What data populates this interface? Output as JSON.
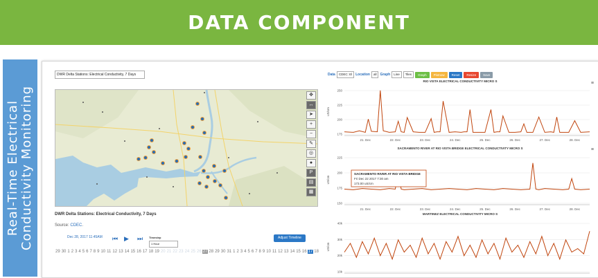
{
  "banner": {
    "title": "DATA COMPONENT"
  },
  "sidebar": {
    "line1": "Real-Time Electrical",
    "line2": "Conductivity Monitoring"
  },
  "left_panel": {
    "station_select": "DWR Delta Stations: Electrical Conductivity, 7 Days",
    "map_title": "DWR Delta Stations: Electrical Conductivity, 7 Days",
    "source_label": "Source:",
    "source_link": "CDEC",
    "timestamp": "Dec 28, 2017 11:45AM",
    "timestep_label": "Timestep",
    "timestep_value": "1 Hour",
    "adjust_button": "Adjust Timeline",
    "map_tools": [
      "pan-icon",
      "zoom-extent-icon",
      "cursor-icon",
      "zoom-in-icon",
      "zoom-out-icon",
      "edit-icon",
      "globe-icon",
      "info-icon",
      "print-icon",
      "layers-icon",
      "basemap-icon"
    ],
    "timeline": [
      "29",
      "30",
      "1",
      "2",
      "3",
      "4",
      "5",
      "6",
      "7",
      "8",
      "9",
      "10",
      "11",
      "12",
      "13",
      "14",
      "15",
      "16",
      "17",
      "18",
      "19",
      "20",
      "21",
      "22",
      "23",
      "24",
      "25",
      "26",
      "27",
      "28",
      "29",
      "30",
      "31",
      "1",
      "2",
      "3",
      "4",
      "5",
      "6",
      "7",
      "8",
      "9",
      "10",
      "11",
      "12",
      "13",
      "14",
      "15",
      "16",
      "17",
      "18"
    ]
  },
  "right_panel": {
    "data_label": "Data",
    "data_value": "CDEC: El",
    "location_label": "Location",
    "location_value": "all",
    "graph_label": "Graph",
    "graph_value": "Line",
    "tiles_value": "Tiles",
    "buttons": {
      "graph": "Graph",
      "plotnow": "Plotnow",
      "reset": "Reset",
      "resize": "Resize",
      "save": "Save"
    },
    "colors": {
      "graph": "#6cbf45",
      "plotnow": "#f5b63f",
      "reset": "#2b78c6",
      "resize": "#e8472f",
      "save": "#8a9ba8",
      "series": "#c0440c"
    },
    "tooltip": {
      "title": "SACRAMENTO RIVER AT RIO VISTA BRIDGE",
      "date": "Fri Dec 22 2017 7:30 am",
      "value": "173.00 uS/cm"
    }
  },
  "chart_data": [
    {
      "type": "line",
      "title": "RIO VISTA ELECTRICAL CONDUCTIVITY MICRO S",
      "ylabel": "uS/cm",
      "y_ticks": [
        "250",
        "225",
        "200",
        "175"
      ],
      "ylim": [
        165,
        255
      ],
      "x_ticks": [
        "21. Dec",
        "22. Dec",
        "23. Dec",
        "24. Dec",
        "25. Dec",
        "26. Dec",
        "27. Dec",
        "28. Dec"
      ],
      "xlim": [
        20.3,
        28.5
      ],
      "x": [
        20.3,
        20.6,
        20.8,
        21.0,
        21.1,
        21.2,
        21.4,
        21.5,
        21.6,
        21.8,
        22.0,
        22.1,
        22.2,
        22.3,
        22.4,
        22.6,
        22.8,
        23.0,
        23.2,
        23.3,
        23.4,
        23.5,
        23.6,
        23.8,
        24.0,
        24.2,
        24.3,
        24.4,
        24.5,
        24.6,
        24.8,
        25.0,
        25.2,
        25.3,
        25.4,
        25.5,
        25.6,
        25.8,
        26.0,
        26.2,
        26.3,
        26.4,
        26.5,
        26.6,
        26.8,
        27.0,
        27.2,
        27.3,
        27.4,
        27.5,
        27.6,
        27.8,
        28.0,
        28.2,
        28.5
      ],
      "values": [
        172,
        171,
        174,
        171,
        196,
        173,
        172,
        250,
        174,
        171,
        172,
        192,
        172,
        171,
        199,
        172,
        171,
        171,
        197,
        171,
        172,
        172,
        230,
        171,
        172,
        171,
        172,
        172,
        214,
        171,
        171,
        171,
        214,
        171,
        172,
        172,
        202,
        171,
        171,
        172,
        187,
        171,
        171,
        171,
        200,
        171,
        172,
        171,
        200,
        171,
        171,
        171,
        193,
        171,
        172
      ]
    },
    {
      "type": "line",
      "title": "SACRAMENTO RIVER AT RIO VISTA BRIDGE ELECTRICAL CONDUCTIVITY MICRO S",
      "ylabel": "uS/cm",
      "y_ticks": [
        "225",
        "200",
        "175",
        "150"
      ],
      "ylim": [
        148,
        228
      ],
      "x_ticks": [
        "21. Dec",
        "22. Dec",
        "23. Dec",
        "24. Dec",
        "25. Dec",
        "26. Dec",
        "27. Dec",
        "28. Dec"
      ],
      "xlim": [
        20.3,
        28.5
      ],
      "x": [
        20.3,
        20.6,
        20.9,
        21.2,
        21.5,
        21.8,
        22.0,
        22.1,
        22.2,
        22.3,
        22.6,
        22.9,
        23.2,
        23.5,
        23.8,
        24.1,
        24.4,
        24.7,
        25.0,
        25.3,
        25.6,
        25.9,
        26.2,
        26.5,
        26.6,
        26.7,
        26.8,
        27.0,
        27.3,
        27.6,
        27.8,
        27.9,
        28.0,
        28.2,
        28.5
      ],
      "values": [
        173,
        172,
        174,
        173,
        172,
        174,
        173,
        200,
        173,
        172,
        173,
        174,
        172,
        173,
        174,
        173,
        172,
        174,
        173,
        172,
        174,
        173,
        172,
        173,
        215,
        173,
        172,
        174,
        173,
        172,
        173,
        190,
        173,
        172,
        173
      ]
    },
    {
      "type": "line",
      "title": "MARTINEZ ELECTRICAL CONDUCTIVITY MICRO S",
      "ylabel": "uS/cm",
      "y_ticks": [
        "40k",
        "30k",
        "20k",
        "10k"
      ],
      "ylim": [
        10000,
        40000
      ],
      "x_ticks": [],
      "xlim": [
        20.3,
        28.5
      ],
      "x": [
        20.3,
        20.5,
        20.7,
        20.9,
        21.1,
        21.3,
        21.5,
        21.7,
        21.9,
        22.1,
        22.3,
        22.5,
        22.7,
        22.9,
        23.1,
        23.3,
        23.5,
        23.7,
        23.9,
        24.1,
        24.3,
        24.5,
        24.7,
        24.9,
        25.1,
        25.3,
        25.5,
        25.7,
        25.9,
        26.1,
        26.3,
        26.5,
        26.7,
        26.9,
        27.1,
        27.3,
        27.5,
        27.7,
        27.9,
        28.1,
        28.3,
        28.5
      ],
      "values": [
        22000,
        27000,
        19000,
        28000,
        21000,
        30000,
        20000,
        27000,
        18000,
        29000,
        22000,
        26000,
        19000,
        30000,
        21000,
        27000,
        18000,
        28000,
        22000,
        31000,
        20000,
        26000,
        19000,
        29000,
        21000,
        27000,
        18000,
        30000,
        22000,
        26000,
        19000,
        28000,
        21000,
        31000,
        20000,
        27000,
        18000,
        29000,
        22000,
        24000,
        21000,
        34000
      ]
    }
  ]
}
